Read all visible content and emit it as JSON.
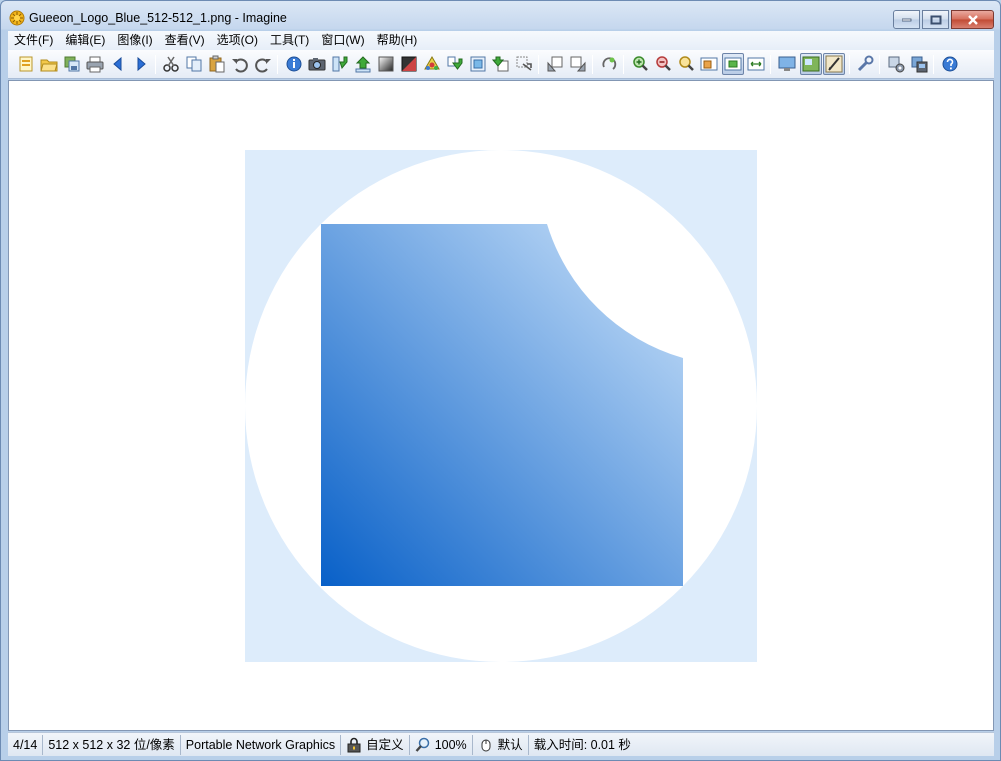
{
  "window": {
    "title": "Gueeon_Logo_Blue_512-512_1.png - Imagine"
  },
  "menu": [
    {
      "label": "文件(F)"
    },
    {
      "label": "编辑(E)"
    },
    {
      "label": "图像(I)"
    },
    {
      "label": "查看(V)"
    },
    {
      "label": "选项(O)"
    },
    {
      "label": "工具(T)"
    },
    {
      "label": "窗口(W)"
    },
    {
      "label": "帮助(H)"
    }
  ],
  "image": {
    "background_color": "#ddecfb",
    "circle_color": "#ffffff",
    "gradient_dark": "#0860c8",
    "gradient_light": "#cfe5fb"
  },
  "status": {
    "index": "4/14",
    "dimensions": "512 x 512 x 32 位/像素",
    "format": "Portable Network Graphics",
    "mode": "自定义",
    "zoom": "100%",
    "mouse_mode": "默认",
    "load_time": "载入时间: 0.01 秒"
  }
}
